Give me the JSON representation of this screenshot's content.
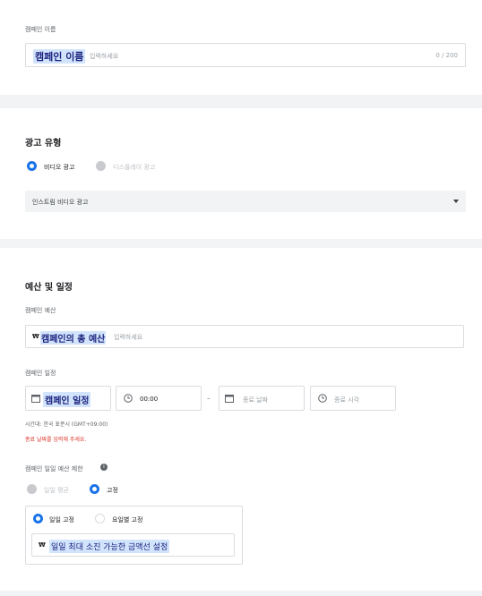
{
  "campaign_name": {
    "label": "캠페인 이름",
    "value": "캠페인 이름",
    "placeholder_tail": "입력하세요",
    "counter": "0 / 200"
  },
  "ad_type": {
    "title": "광고 유형",
    "option_video": "비디오 광고",
    "option_display": "디스플레이 광고",
    "select_value": "인스트림 비디오 광고"
  },
  "budget": {
    "title": "예산 및 일정",
    "budget_label": "캠페인 예산",
    "currency": "₩",
    "budget_value": "캠페인의 총 예산",
    "budget_placeholder_tail": "입력하세요",
    "schedule_label": "캠페인 일정",
    "start_date": "캠페인 일정",
    "start_time": "00:00",
    "dash": "–",
    "end_date_placeholder": "종료 날짜",
    "end_time_placeholder": "종료 시각",
    "timezone": "시간대: 한국 표준시 (GMT+09:00)",
    "error": "종료 날짜를 입력해 주세요.",
    "daily_limit_label": "캠페인 일일 예산 제한",
    "opt_daily_avg": "일일 평균",
    "opt_fixed": "고정",
    "sub_opt_daily_fixed": "일일 고정",
    "sub_opt_weekday_fixed": "요일별 고정",
    "daily_currency": "₩",
    "daily_value": "일일 최대 소진 가능한 금액선 설정"
  },
  "colors": {
    "accent": "#1a73e8",
    "error": "#d93025",
    "highlight": "#d2e3fc"
  }
}
